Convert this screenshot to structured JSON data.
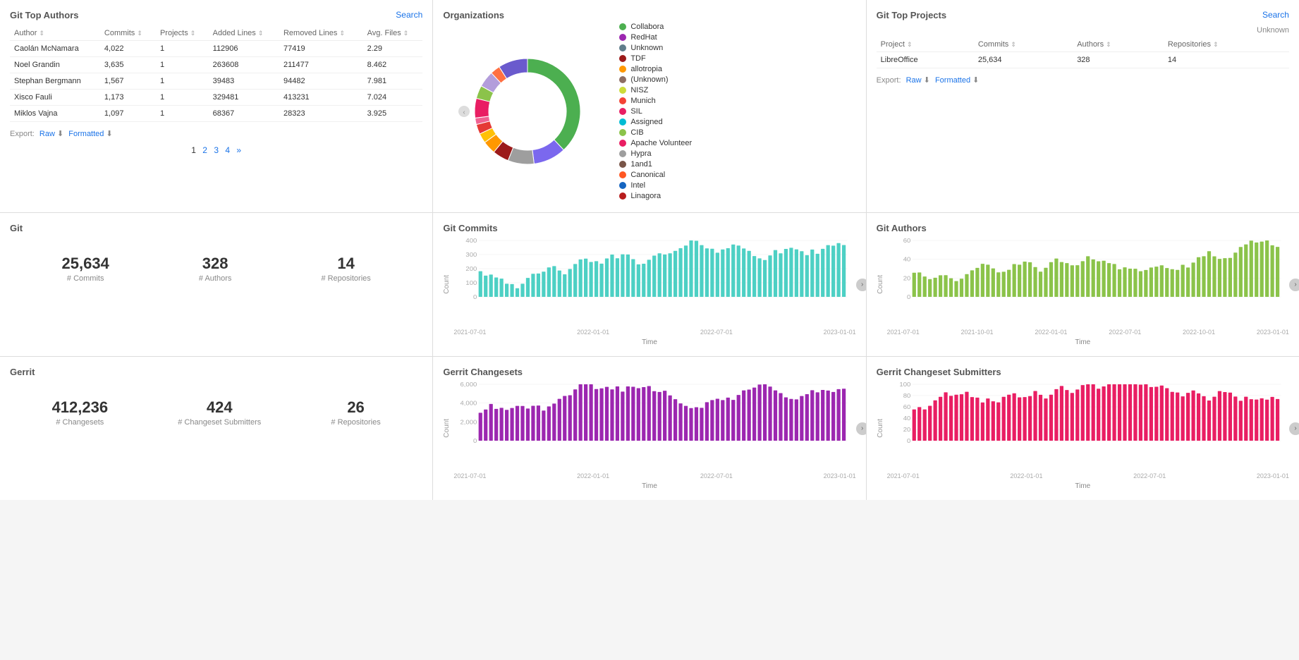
{
  "gitTopAuthors": {
    "title": "Git Top Authors",
    "searchLabel": "Search",
    "columns": [
      "Author",
      "Commits",
      "Projects",
      "Added Lines",
      "Removed Lines",
      "Avg. Files"
    ],
    "rows": [
      {
        "author": "Caolán McNamara",
        "commits": "4,022",
        "projects": "1",
        "addedLines": "112906",
        "removedLines": "77419",
        "avgFiles": "2.29"
      },
      {
        "author": "Noel Grandin",
        "commits": "3,635",
        "projects": "1",
        "addedLines": "263608",
        "removedLines": "211477",
        "avgFiles": "8.462"
      },
      {
        "author": "Stephan Bergmann",
        "commits": "1,567",
        "projects": "1",
        "addedLines": "39483",
        "removedLines": "94482",
        "avgFiles": "7.981"
      },
      {
        "author": "Xisco Fauli",
        "commits": "1,173",
        "projects": "1",
        "addedLines": "329481",
        "removedLines": "413231",
        "avgFiles": "7.024"
      },
      {
        "author": "Miklos Vajna",
        "commits": "1,097",
        "projects": "1",
        "addedLines": "68367",
        "removedLines": "28323",
        "avgFiles": "3.925"
      }
    ],
    "exportLabel": "Export:",
    "rawLabel": "Raw",
    "formattedLabel": "Formatted",
    "pagination": [
      "1",
      "2",
      "3",
      "4",
      "»"
    ]
  },
  "organizations": {
    "title": "Organizations",
    "legend": [
      {
        "name": "Collabora",
        "color": "#4CAF50"
      },
      {
        "name": "RedHat",
        "color": "#9C27B0"
      },
      {
        "name": "Unknown",
        "color": "#607D8B"
      },
      {
        "name": "TDF",
        "color": "#9C1A1A"
      },
      {
        "name": "allotropia",
        "color": "#FF9800"
      },
      {
        "name": "(Unknown)",
        "color": "#8D6E63"
      },
      {
        "name": "NISZ",
        "color": "#CDDC39"
      },
      {
        "name": "Munich",
        "color": "#F44336"
      },
      {
        "name": "SIL",
        "color": "#E91E63"
      },
      {
        "name": "Assigned",
        "color": "#00BCD4"
      },
      {
        "name": "CIB",
        "color": "#8BC34A"
      },
      {
        "name": "Apache Volunteer",
        "color": "#E91E63"
      },
      {
        "name": "Hypra",
        "color": "#9E9E9E"
      },
      {
        "name": "1and1",
        "color": "#795548"
      },
      {
        "name": "Canonical",
        "color": "#FF5722"
      },
      {
        "name": "Intel",
        "color": "#1565C0"
      },
      {
        "name": "Linagora",
        "color": "#B71C1C"
      }
    ],
    "donut": {
      "segments": [
        {
          "color": "#4CAF50",
          "pct": 38
        },
        {
          "color": "#7B68EE",
          "pct": 10
        },
        {
          "color": "#9E9E9E",
          "pct": 8
        },
        {
          "color": "#9C1A1A",
          "pct": 5
        },
        {
          "color": "#FF9800",
          "pct": 4
        },
        {
          "color": "#FFC107",
          "pct": 3
        },
        {
          "color": "#E53935",
          "pct": 3
        },
        {
          "color": "#F06292",
          "pct": 2
        },
        {
          "color": "#E91E63",
          "pct": 6
        },
        {
          "color": "#8BC34A",
          "pct": 4
        },
        {
          "color": "#B39DDB",
          "pct": 5
        },
        {
          "color": "#FF7043",
          "pct": 3
        },
        {
          "color": "#6A5ACD",
          "pct": 9
        }
      ]
    }
  },
  "gitTopProjects": {
    "title": "Git Top Projects",
    "searchLabel": "Search",
    "columns": [
      "Project",
      "Commits",
      "Authors",
      "Repositories"
    ],
    "rows": [
      {
        "project": "LibreOffice",
        "commits": "25,634",
        "authors": "328",
        "repositories": "14"
      }
    ],
    "exportLabel": "Export:",
    "rawLabel": "Raw",
    "formattedLabel": "Formatted",
    "unknownLabel": "Unknown"
  },
  "git": {
    "title": "Git",
    "stats": [
      {
        "number": "25,634",
        "label": "# Commits"
      },
      {
        "number": "328",
        "label": "# Authors"
      },
      {
        "number": "14",
        "label": "# Repositories"
      }
    ]
  },
  "gitCommits": {
    "title": "Git Commits",
    "yLabel": "Count",
    "xLabel": "Time",
    "yMax": 400,
    "yTicks": [
      "400",
      "300",
      "200",
      "100",
      "0"
    ],
    "xTicks": [
      "2021-07-01",
      "2022-01-01",
      "2022-07-01",
      "2023-01-01"
    ],
    "color": "#4DD0C4"
  },
  "gitAuthors": {
    "title": "Git Authors",
    "yLabel": "Count",
    "xLabel": "Time",
    "yMax": 60,
    "yTicks": [
      "60",
      "40",
      "20",
      "0"
    ],
    "xTicks": [
      "2021-07-01",
      "2021-10-01",
      "2022-01-01",
      "2022-07-01",
      "2022-10-01",
      "2023-01-01"
    ],
    "color": "#8BC34A"
  },
  "gerrit": {
    "title": "Gerrit",
    "stats": [
      {
        "number": "412,236",
        "label": "# Changesets"
      },
      {
        "number": "424",
        "label": "# Changeset Submitters"
      },
      {
        "number": "26",
        "label": "# Repositories"
      }
    ]
  },
  "gerritChangesets": {
    "title": "Gerrit Changesets",
    "yLabel": "Count",
    "xLabel": "Time",
    "yMax": 6000,
    "yTicks": [
      "6,000",
      "4,000",
      "2,000",
      "0"
    ],
    "xTicks": [
      "2021-07-01",
      "2022-01-01",
      "2022-07-01",
      "2023-01-01"
    ],
    "color": "#9C27B0"
  },
  "gerritSubmitters": {
    "title": "Gerrit Changeset Submitters",
    "yLabel": "Count",
    "xLabel": "Time",
    "yMax": 100,
    "yTicks": [
      "100",
      "80",
      "60",
      "40",
      "20",
      "0"
    ],
    "xTicks": [
      "2021-07-01",
      "2022-01-01",
      "2022-07-01",
      "2023-01-01"
    ],
    "color": "#E91E63"
  }
}
